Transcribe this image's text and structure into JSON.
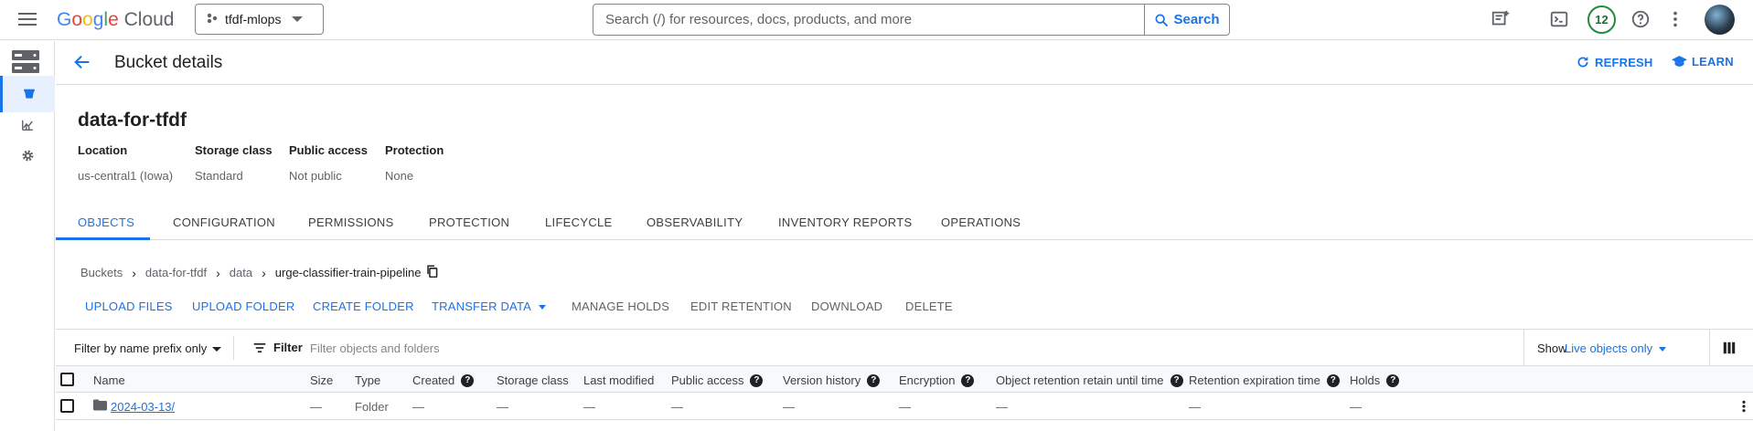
{
  "topbar": {
    "logo": {
      "G": "G",
      "o1": "o",
      "o2": "o",
      "g": "g",
      "l": "l",
      "e": "e",
      "cloud": "Cloud"
    },
    "project": "tfdf-mlops",
    "search_placeholder": "Search (/) for resources, docs, products, and more",
    "search_button": "Search",
    "notifications_count": "12"
  },
  "header": {
    "title": "Bucket details",
    "refresh": "REFRESH",
    "learn": "LEARN"
  },
  "bucket": {
    "name": "data-for-tfdf",
    "meta": [
      {
        "label": "Location",
        "value": "us-central1 (Iowa)"
      },
      {
        "label": "Storage class",
        "value": "Standard"
      },
      {
        "label": "Public access",
        "value": "Not public"
      },
      {
        "label": "Protection",
        "value": "None"
      }
    ]
  },
  "tabs": [
    "OBJECTS",
    "CONFIGURATION",
    "PERMISSIONS",
    "PROTECTION",
    "LIFECYCLE",
    "OBSERVABILITY",
    "INVENTORY REPORTS",
    "OPERATIONS"
  ],
  "breadcrumb": [
    "Buckets",
    "data-for-tfdf",
    "data",
    "urge-classifier-train-pipeline"
  ],
  "actions": {
    "upload_files": "UPLOAD FILES",
    "upload_folder": "UPLOAD FOLDER",
    "create_folder": "CREATE FOLDER",
    "transfer_data": "TRANSFER DATA",
    "manage_holds": "MANAGE HOLDS",
    "edit_retention": "EDIT RETENTION",
    "download": "DOWNLOAD",
    "delete": "DELETE"
  },
  "filter": {
    "prefix_label": "Filter by name prefix only",
    "filter_label": "Filter",
    "placeholder": "Filter objects and folders",
    "show_label": "Show",
    "show_value": "Live objects only"
  },
  "table": {
    "headers": {
      "name": "Name",
      "size": "Size",
      "type": "Type",
      "created": "Created",
      "storage_class": "Storage class",
      "last_modified": "Last modified",
      "public_access": "Public access",
      "version_history": "Version history",
      "encryption": "Encryption",
      "object_retention": "Object retention retain until time",
      "retention_expiration": "Retention expiration time",
      "holds": "Holds"
    },
    "rows": [
      {
        "name": "2024-03-13/",
        "size": "—",
        "type": "Folder",
        "created": "—",
        "storage_class": "—",
        "last_modified": "—",
        "public_access": "—",
        "version_history": "—",
        "encryption": "—",
        "object_retention": "—",
        "retention_expiration": "—",
        "holds": "—"
      }
    ]
  },
  "help_glyph": "?"
}
